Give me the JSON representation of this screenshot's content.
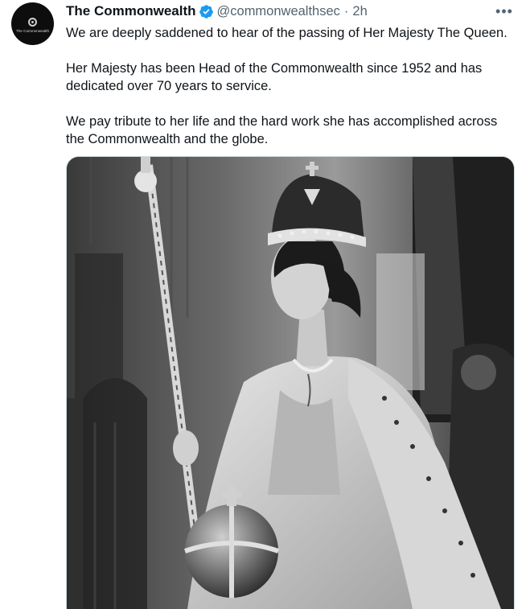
{
  "account": {
    "display_name": "The Commonwealth",
    "handle": "@commonwealthsec",
    "separator": "·",
    "timestamp": "2h",
    "avatar_text": "The Commonwealth",
    "verified": true
  },
  "more_label": "•••",
  "tweet": {
    "paragraphs": [
      "We are deeply saddened to hear of the passing of Her Majesty The Queen.",
      "Her Majesty has been Head of the Commonwealth since 1952 and has dedicated over 70 years to service.",
      "We pay tribute to her life and the hard work she has accomplished across the Commonwealth and the globe."
    ]
  },
  "media": {
    "type": "photo",
    "tone": "black-and-white",
    "subject": "coronation-portrait"
  },
  "colors": {
    "text": "#0f1419",
    "secondary": "#536471",
    "verified": "#1d9bf0",
    "border": "#cfd9de"
  }
}
